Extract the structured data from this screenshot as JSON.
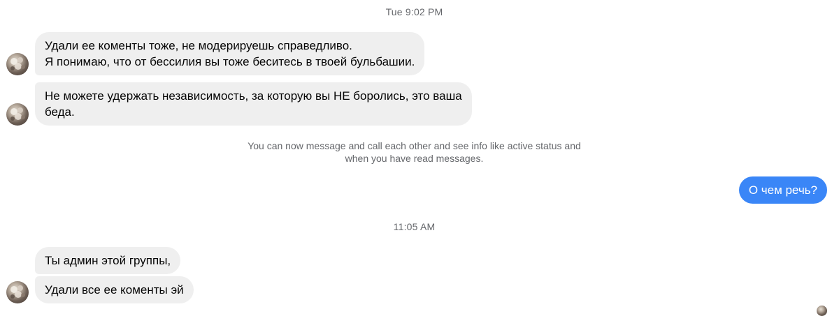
{
  "timestamps": {
    "first": "Tue 9:02 PM",
    "second": "11:05 AM"
  },
  "messages": [
    {
      "direction": "incoming",
      "lines": [
        "Удали ее коменты тоже, не модерируешь справедливо.",
        "Я понимаю, что от бессилия вы тоже беситесь в твоей бульбашии."
      ]
    },
    {
      "direction": "incoming",
      "lines": [
        "Не можете удержать независимость, за которую вы НЕ боролись,  это ваша",
        "беда."
      ]
    },
    {
      "direction": "outgoing",
      "text": "О чем речь?"
    },
    {
      "direction": "incoming",
      "text": "Ты админ этой группы,"
    },
    {
      "direction": "incoming",
      "text": "Удали все ее коменты эй"
    }
  ],
  "system_notice": {
    "line1": "You can now message and call each other and see info like active status and",
    "line2": "when you have read messages."
  },
  "icons": {
    "avatar": "contact-avatar-photo",
    "read_receipt": "read-receipt-avatar"
  },
  "colors": {
    "incoming_bubble": "#efefef",
    "outgoing_bubble": "#3a86f7",
    "meta_text": "#65676b"
  }
}
